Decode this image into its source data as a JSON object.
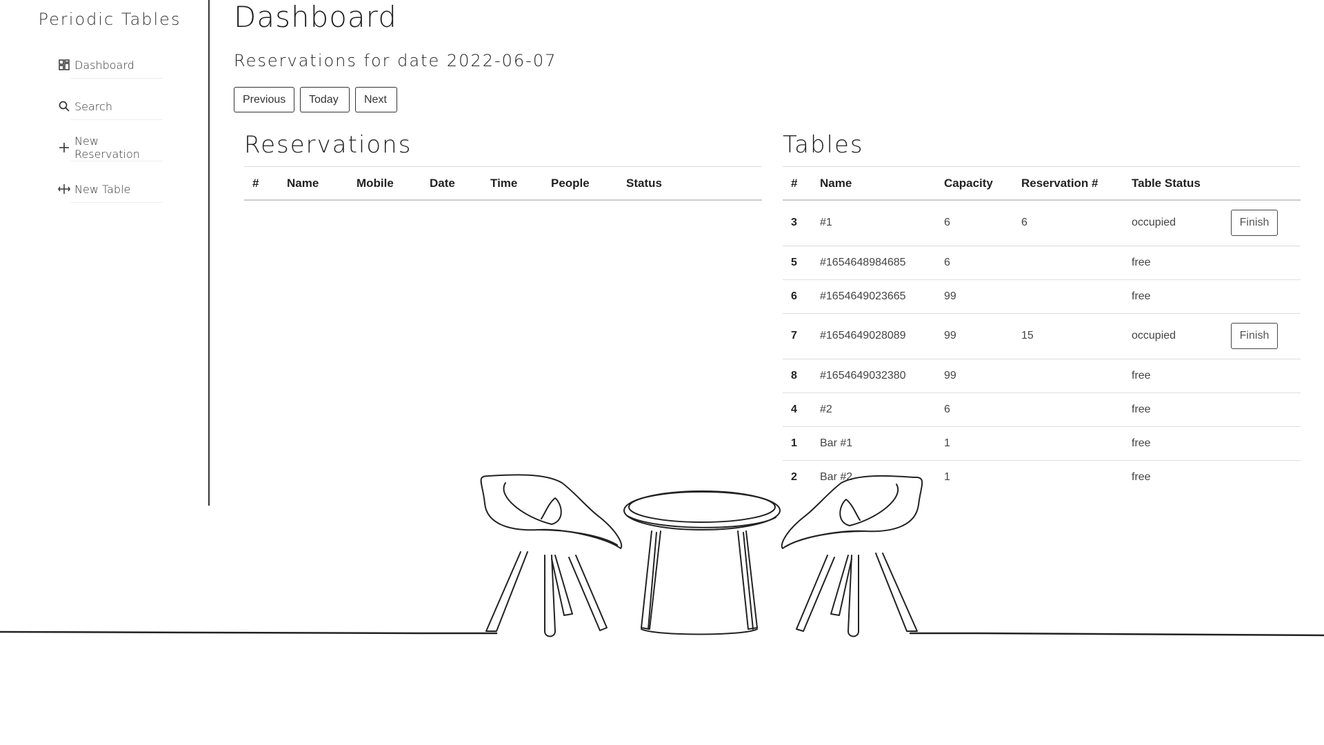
{
  "sidebar": {
    "brand": "Periodic Tables",
    "items": [
      {
        "label": "Dashboard",
        "icon": "dashboard-icon"
      },
      {
        "label": "Search",
        "icon": "search-icon"
      },
      {
        "label": "New Reservation",
        "icon": "plus-icon"
      },
      {
        "label": "New Table",
        "icon": "table-icon"
      }
    ]
  },
  "main": {
    "title": "Dashboard",
    "date_heading": "Reservations for date 2022-06-07",
    "buttons": {
      "previous": "Previous",
      "today": "Today",
      "next": "Next"
    }
  },
  "reservations": {
    "title": "Reservations",
    "headers": [
      "#",
      "Name",
      "Mobile",
      "Date",
      "Time",
      "People",
      "Status"
    ],
    "rows": []
  },
  "tables": {
    "title": "Tables",
    "headers": [
      "#",
      "Name",
      "Capacity",
      "Reservation #",
      "Table Status"
    ],
    "finish_label": "Finish",
    "rows": [
      {
        "id": "3",
        "name": "#1",
        "capacity": "6",
        "reservation": "6",
        "status": "occupied"
      },
      {
        "id": "5",
        "name": "#1654648984685",
        "capacity": "6",
        "reservation": "",
        "status": "free"
      },
      {
        "id": "6",
        "name": "#1654649023665",
        "capacity": "99",
        "reservation": "",
        "status": "free"
      },
      {
        "id": "7",
        "name": "#1654649028089",
        "capacity": "99",
        "reservation": "15",
        "status": "occupied"
      },
      {
        "id": "8",
        "name": "#1654649032380",
        "capacity": "99",
        "reservation": "",
        "status": "free"
      },
      {
        "id": "4",
        "name": "#2",
        "capacity": "6",
        "reservation": "",
        "status": "free"
      },
      {
        "id": "1",
        "name": "Bar #1",
        "capacity": "1",
        "reservation": "",
        "status": "free"
      },
      {
        "id": "2",
        "name": "Bar #2",
        "capacity": "1",
        "reservation": "",
        "status": "free"
      }
    ]
  }
}
